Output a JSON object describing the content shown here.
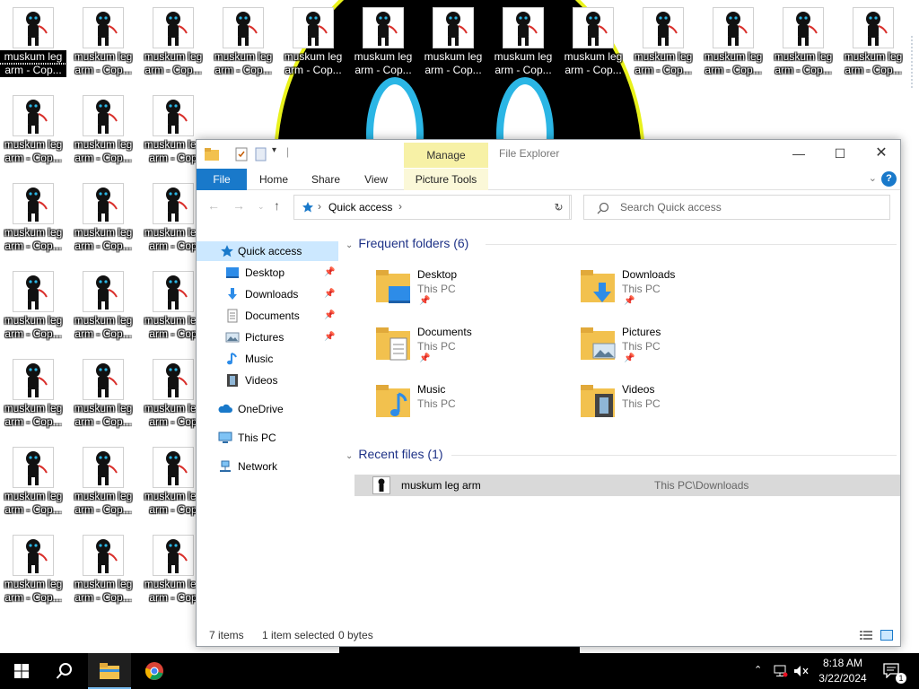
{
  "desktop": {
    "icon_label_line1": "muskum leg",
    "icon_label_line2": "arm - Cop...",
    "icon_label_line2_short": "arm - Cop"
  },
  "explorer": {
    "title": "File Explorer",
    "manage_tab": "Manage",
    "ribbon": {
      "file": "File",
      "home": "Home",
      "share": "Share",
      "view": "View",
      "picture_tools": "Picture Tools",
      "help": "?"
    },
    "address": {
      "path": "Quick access",
      "search_placeholder": "Search Quick access"
    },
    "nav_pane": {
      "quick_access": "Quick access",
      "desktop": "Desktop",
      "downloads": "Downloads",
      "documents": "Documents",
      "pictures": "Pictures",
      "music": "Music",
      "videos": "Videos",
      "onedrive": "OneDrive",
      "this_pc": "This PC",
      "network": "Network"
    },
    "frequent_header": "Frequent folders (6)",
    "frequent_folders": [
      {
        "name": "Desktop",
        "location": "This PC",
        "pinned": true
      },
      {
        "name": "Downloads",
        "location": "This PC",
        "pinned": true
      },
      {
        "name": "Documents",
        "location": "This PC",
        "pinned": true
      },
      {
        "name": "Pictures",
        "location": "This PC",
        "pinned": true
      },
      {
        "name": "Music",
        "location": "This PC",
        "pinned": false
      },
      {
        "name": "Videos",
        "location": "This PC",
        "pinned": false
      }
    ],
    "recent_header": "Recent files (1)",
    "recent_files": [
      {
        "name": "muskum leg arm",
        "path": "This PC\\Downloads"
      }
    ],
    "status": {
      "items": "7 items",
      "selected": "1 item selected",
      "size": "0 bytes"
    }
  },
  "taskbar": {
    "time": "8:18 AM",
    "date": "3/22/2024"
  },
  "colors": {
    "accent": "#1979ca",
    "manage_tab": "#f7f1a6",
    "selection": "#cce8ff",
    "header_text": "#1e3287"
  }
}
